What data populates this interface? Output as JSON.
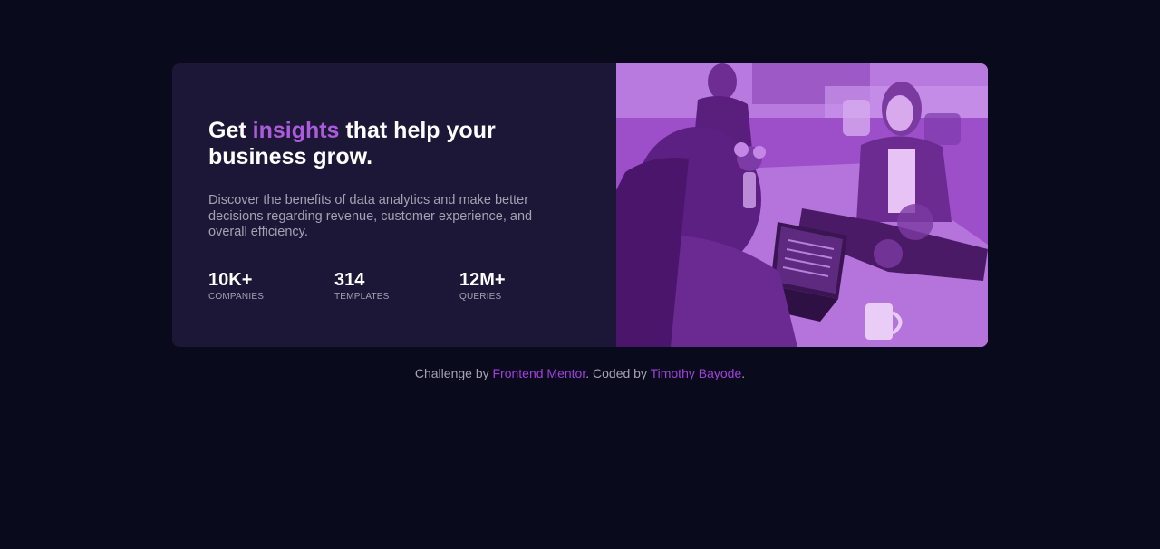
{
  "card": {
    "headline": {
      "before": "Get ",
      "accent": "insights",
      "after": " that help your business grow."
    },
    "description": "Discover the benefits of data analytics and make better decisions regarding revenue, customer experience, and overall efficiency.",
    "stats": [
      {
        "value": "10K+",
        "label": "COMPANIES"
      },
      {
        "value": "314",
        "label": "TEMPLATES"
      },
      {
        "value": "12M+",
        "label": "QUERIES"
      }
    ],
    "image": {
      "icon": "office-team-photo",
      "tint_color": "#a45bd0"
    }
  },
  "footer": {
    "prefix": "Challenge by ",
    "link1": "Frontend Mentor",
    "middle": ". Coded by ",
    "link2": "Timothy Bayode",
    "suffix": "."
  },
  "colors": {
    "background": "#090b1d",
    "card": "#1c1637",
    "accent": "#ab5cdb",
    "muted_text": "#a4a1b3"
  }
}
